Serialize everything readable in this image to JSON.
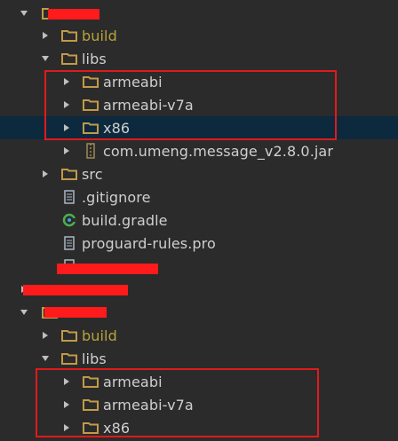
{
  "colors": {
    "background": "#2b2b2b",
    "selected_row": "#0d293e",
    "folder_icon": "#c29a48",
    "excluded_label": "#b8a33a",
    "highlight_box": "#e01b1b",
    "redaction": "#ff1b1b"
  },
  "tree": {
    "project1": {
      "build": "build",
      "libs": "libs",
      "armeabi": "armeabi",
      "armeabi_v7a": "armeabi-v7a",
      "x86": "x86",
      "jar": "com.umeng.message_v2.8.0.jar",
      "src": "src",
      "gitignore": ".gitignore",
      "build_gradle": "build.gradle",
      "proguard": "proguard-rules.pro"
    },
    "project2": {
      "build": "build",
      "libs": "libs",
      "armeabi": "armeabi",
      "armeabi_v7a": "armeabi-v7a",
      "x86": "x86"
    }
  },
  "icons": {
    "expanded": "triangle-down-icon",
    "collapsed": "triangle-right-icon",
    "folder": "folder-icon",
    "module": "module-folder-icon",
    "jar": "jar-icon",
    "file": "file-icon",
    "gradle": "gradle-icon"
  }
}
